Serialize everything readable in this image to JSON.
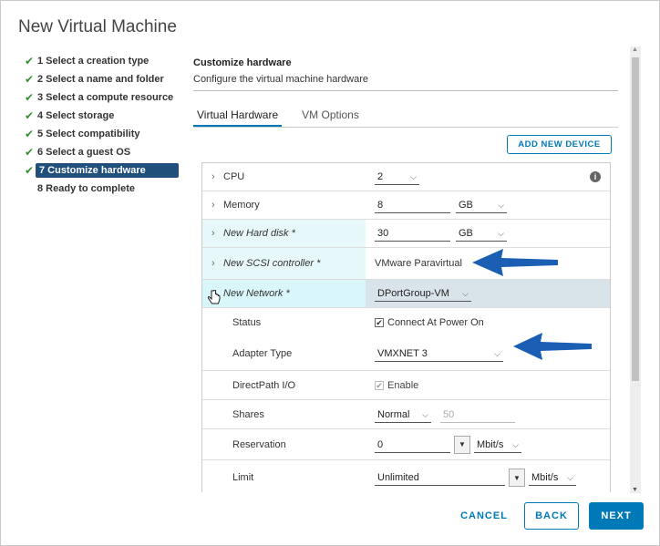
{
  "dialog": {
    "title": "New Virtual Machine"
  },
  "steps": [
    {
      "label": "1 Select a creation type",
      "done": true
    },
    {
      "label": "2 Select a name and folder",
      "done": true
    },
    {
      "label": "3 Select a compute resource",
      "done": true
    },
    {
      "label": "4 Select storage",
      "done": true
    },
    {
      "label": "5 Select compatibility",
      "done": true
    },
    {
      "label": "6 Select a guest OS",
      "done": true
    },
    {
      "label": "7 Customize hardware",
      "done": true,
      "active": true
    },
    {
      "label": "8 Ready to complete",
      "done": false
    }
  ],
  "section": {
    "title": "Customize hardware",
    "subtitle": "Configure the virtual machine hardware"
  },
  "tabs": [
    {
      "label": "Virtual Hardware",
      "active": true
    },
    {
      "label": "VM Options",
      "active": false
    }
  ],
  "add_device_label": "ADD NEW DEVICE",
  "hardware": {
    "cpu": {
      "label": "CPU",
      "value": "2"
    },
    "memory": {
      "label": "Memory",
      "value": "8",
      "unit": "GB"
    },
    "hard_disk": {
      "label": "New Hard disk *",
      "value": "30",
      "unit": "GB"
    },
    "scsi": {
      "label": "New SCSI controller *",
      "value": "VMware Paravirtual"
    },
    "network": {
      "label": "New Network *",
      "value": "DPortGroup-VM",
      "status_label": "Status",
      "status_value": "Connect At Power On",
      "adapter_label": "Adapter Type",
      "adapter_value": "VMXNET 3",
      "directpath_label": "DirectPath I/O",
      "directpath_value": "Enable",
      "shares_label": "Shares",
      "shares_value": "Normal",
      "shares_num": "50",
      "reservation_label": "Reservation",
      "reservation_value": "0",
      "reservation_unit": "Mbit/s",
      "limit_label": "Limit",
      "limit_value": "Unlimited",
      "limit_unit": "Mbit/s"
    }
  },
  "footer": {
    "cancel": "CANCEL",
    "back": "BACK",
    "next": "NEXT"
  },
  "colors": {
    "accent": "#0079b8",
    "active_step": "#1f4f7a",
    "check": "#3a8d3a",
    "annotation_arrow": "#1a5fb4"
  },
  "icons": {
    "step_done": "checkmark-icon",
    "info": "info-icon",
    "pointer": "hand-cursor-icon"
  }
}
